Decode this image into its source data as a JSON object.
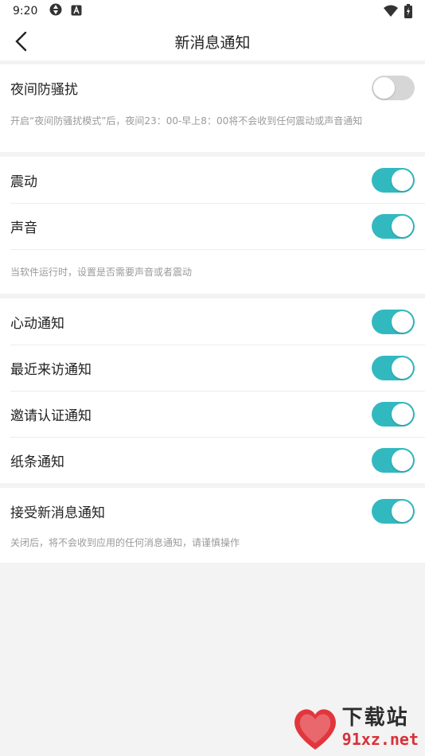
{
  "status_bar": {
    "time": "9:20",
    "icons": [
      "aperture-icon",
      "a-box-icon",
      "wifi-icon",
      "battery-charging-icon"
    ]
  },
  "nav": {
    "title": "新消息通知",
    "back_icon": "chevron-left-icon"
  },
  "sections": [
    {
      "items": [
        {
          "label": "夜间防骚扰",
          "enabled": false
        }
      ],
      "note": "开启“夜间防骚扰模式”后，夜间23：00-早上8：00将不会收到任何震动或声音通知"
    },
    {
      "items": [
        {
          "label": "震动",
          "enabled": true
        },
        {
          "label": "声音",
          "enabled": true
        }
      ],
      "note": "当软件运行时，设置是否需要声音或者震动"
    },
    {
      "items": [
        {
          "label": "心动通知",
          "enabled": true
        },
        {
          "label": "最近来访通知",
          "enabled": true
        },
        {
          "label": "邀请认证通知",
          "enabled": true
        },
        {
          "label": "纸条通知",
          "enabled": true
        }
      ]
    },
    {
      "items": [
        {
          "label": "接受新消息通知",
          "enabled": true
        }
      ],
      "note": "关闭后，将不会收到应用的任何消息通知，请谨慎操作"
    }
  ],
  "colors": {
    "accent": "#32b9c0",
    "toggle_off": "#d6d6d6",
    "background": "#f3f3f3",
    "note_text": "#9a9a9a"
  },
  "watermark": {
    "logo_text": "91",
    "line1": "下载站",
    "line2": "91xz.net"
  }
}
